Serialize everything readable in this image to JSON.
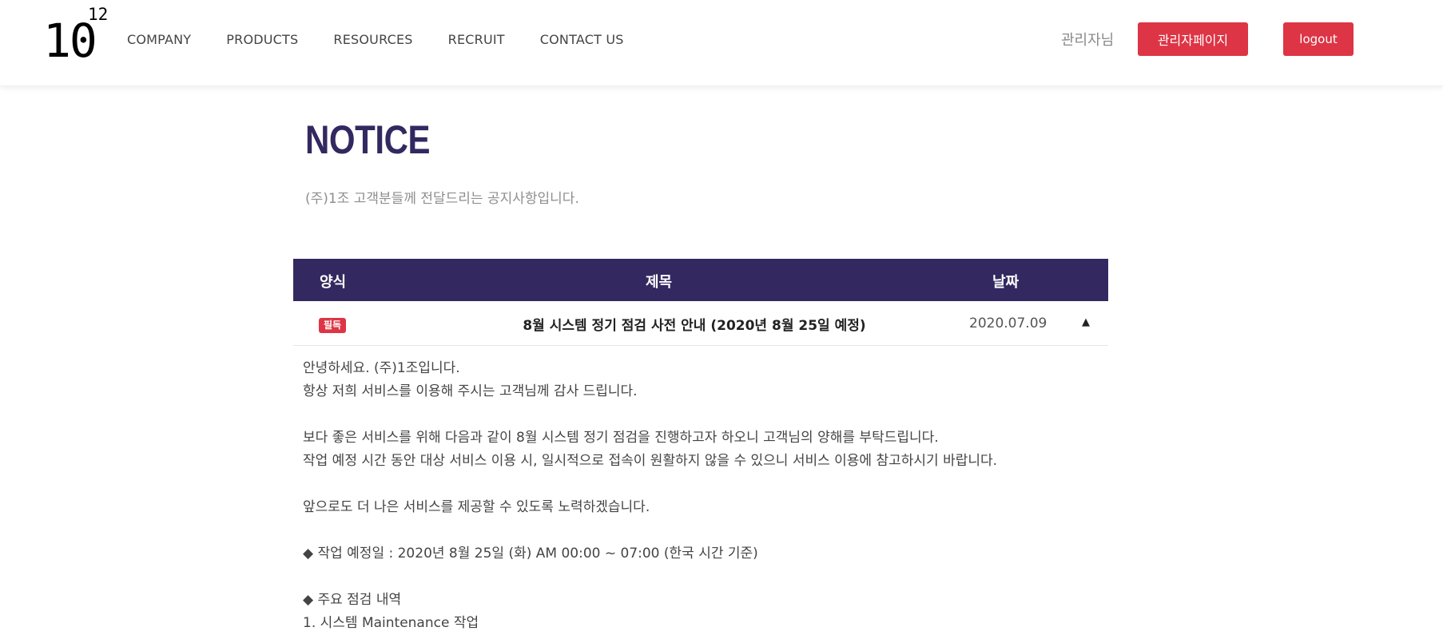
{
  "header": {
    "logo_main": "10",
    "logo_exp": "12",
    "nav": [
      "COMPANY",
      "PRODUCTS",
      "RESOURCES",
      "RECRUIT",
      "CONTACT US"
    ],
    "admin_name": "관리자님",
    "admin_button": "관리자페이지",
    "logout_button": "logout"
  },
  "page": {
    "title": "NOTICE",
    "subtitle": "(주)1조 고객분들께 전달드리는 공지사항입니다."
  },
  "table": {
    "columns": [
      "양식",
      "제목",
      "날짜"
    ],
    "row": {
      "badge": "필독",
      "title": "8월 시스템 정기 점검 사전 안내 (2020년 8월 25일 예정)",
      "date": "2020.07.09",
      "toggle_icon": "▲"
    }
  },
  "content": {
    "lines": [
      "안녕하세요. (주)1조입니다.",
      "항상 저희 서비스를 이용해 주시는 고객님께 감사 드립니다.",
      "",
      "보다 좋은 서비스를 위해 다음과 같이 8월 시스템 정기 점검을 진행하고자 하오니 고객님의 양해를 부탁드립니다.",
      "작업 예정 시간 동안 대상 서비스 이용 시, 일시적으로 접속이 원활하지 않을 수 있으니 서비스 이용에 참고하시기 바랍니다.",
      "",
      "앞으로도 더 나은 서비스를 제공할 수 있도록 노력하겠습니다.",
      "",
      "◆ 작업 예정일 : 2020년 8월 25일 (화) AM 00:00 ~ 07:00 (한국 시간 기준)",
      "",
      "◆ 주요 점검 내역",
      "1. 시스템 Maintenance 작업"
    ]
  },
  "colors": {
    "brand_navy": "#332960",
    "accent_red": "#dd3545"
  }
}
